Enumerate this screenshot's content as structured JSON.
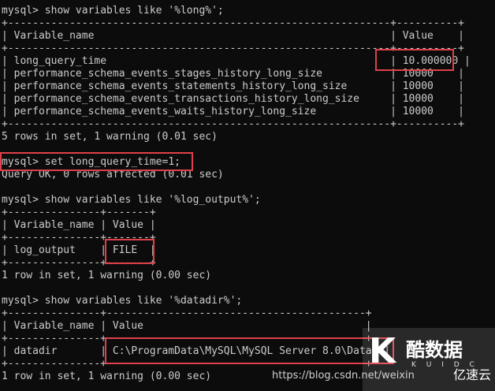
{
  "terminal": {
    "lines": [
      "mysql> show variables like '%long%';",
      "+--------------------------------------------------------------+----------+",
      "| Variable_name                                                | Value    |",
      "+--------------------------------------------------------------+----------+",
      "| long_query_time                                              | 10.000000 |",
      "| performance_schema_events_stages_history_long_size           | 10000    |",
      "| performance_schema_events_statements_history_long_size       | 10000    |",
      "| performance_schema_events_transactions_history_long_size     | 10000    |",
      "| performance_schema_events_waits_history_long_size            | 10000    |",
      "+--------------------------------------------------------------+----------+",
      "5 rows in set, 1 warning (0.01 sec)",
      "mysql> set long_query_time=1;",
      "Query OK, 0 rows affected (0.01 sec)",
      "mysql> show variables like '%log_output%';",
      "+---------------+-------+",
      "| Variable_name | Value |",
      "+---------------+-------+",
      "| log_output    | FILE  |",
      "+---------------+-------+",
      "1 row in set, 1 warning (0.00 sec)",
      "mysql> show variables like '%datadir%';",
      "+---------------+------------------------------------------+",
      "| Variable_name | Value                                    |",
      "+---------------+------------------------------------------+",
      "| datadir       | C:\\ProgramData\\MySQL\\MySQL Server 8.0\\Data\\ |",
      "+---------------+------------------------------------------+",
      "1 row in set, 1 warning (0.00 sec)"
    ]
  },
  "watermark": {
    "url": "https://blog.csdn.net/weixin",
    "logo_glyph": "K",
    "brand": "酷数据",
    "sub": "K U I D C",
    "yun": "亿速云"
  },
  "colors": {
    "background": "#0c0c0c",
    "text": "#cccccc",
    "highlight": "#e0404a"
  }
}
